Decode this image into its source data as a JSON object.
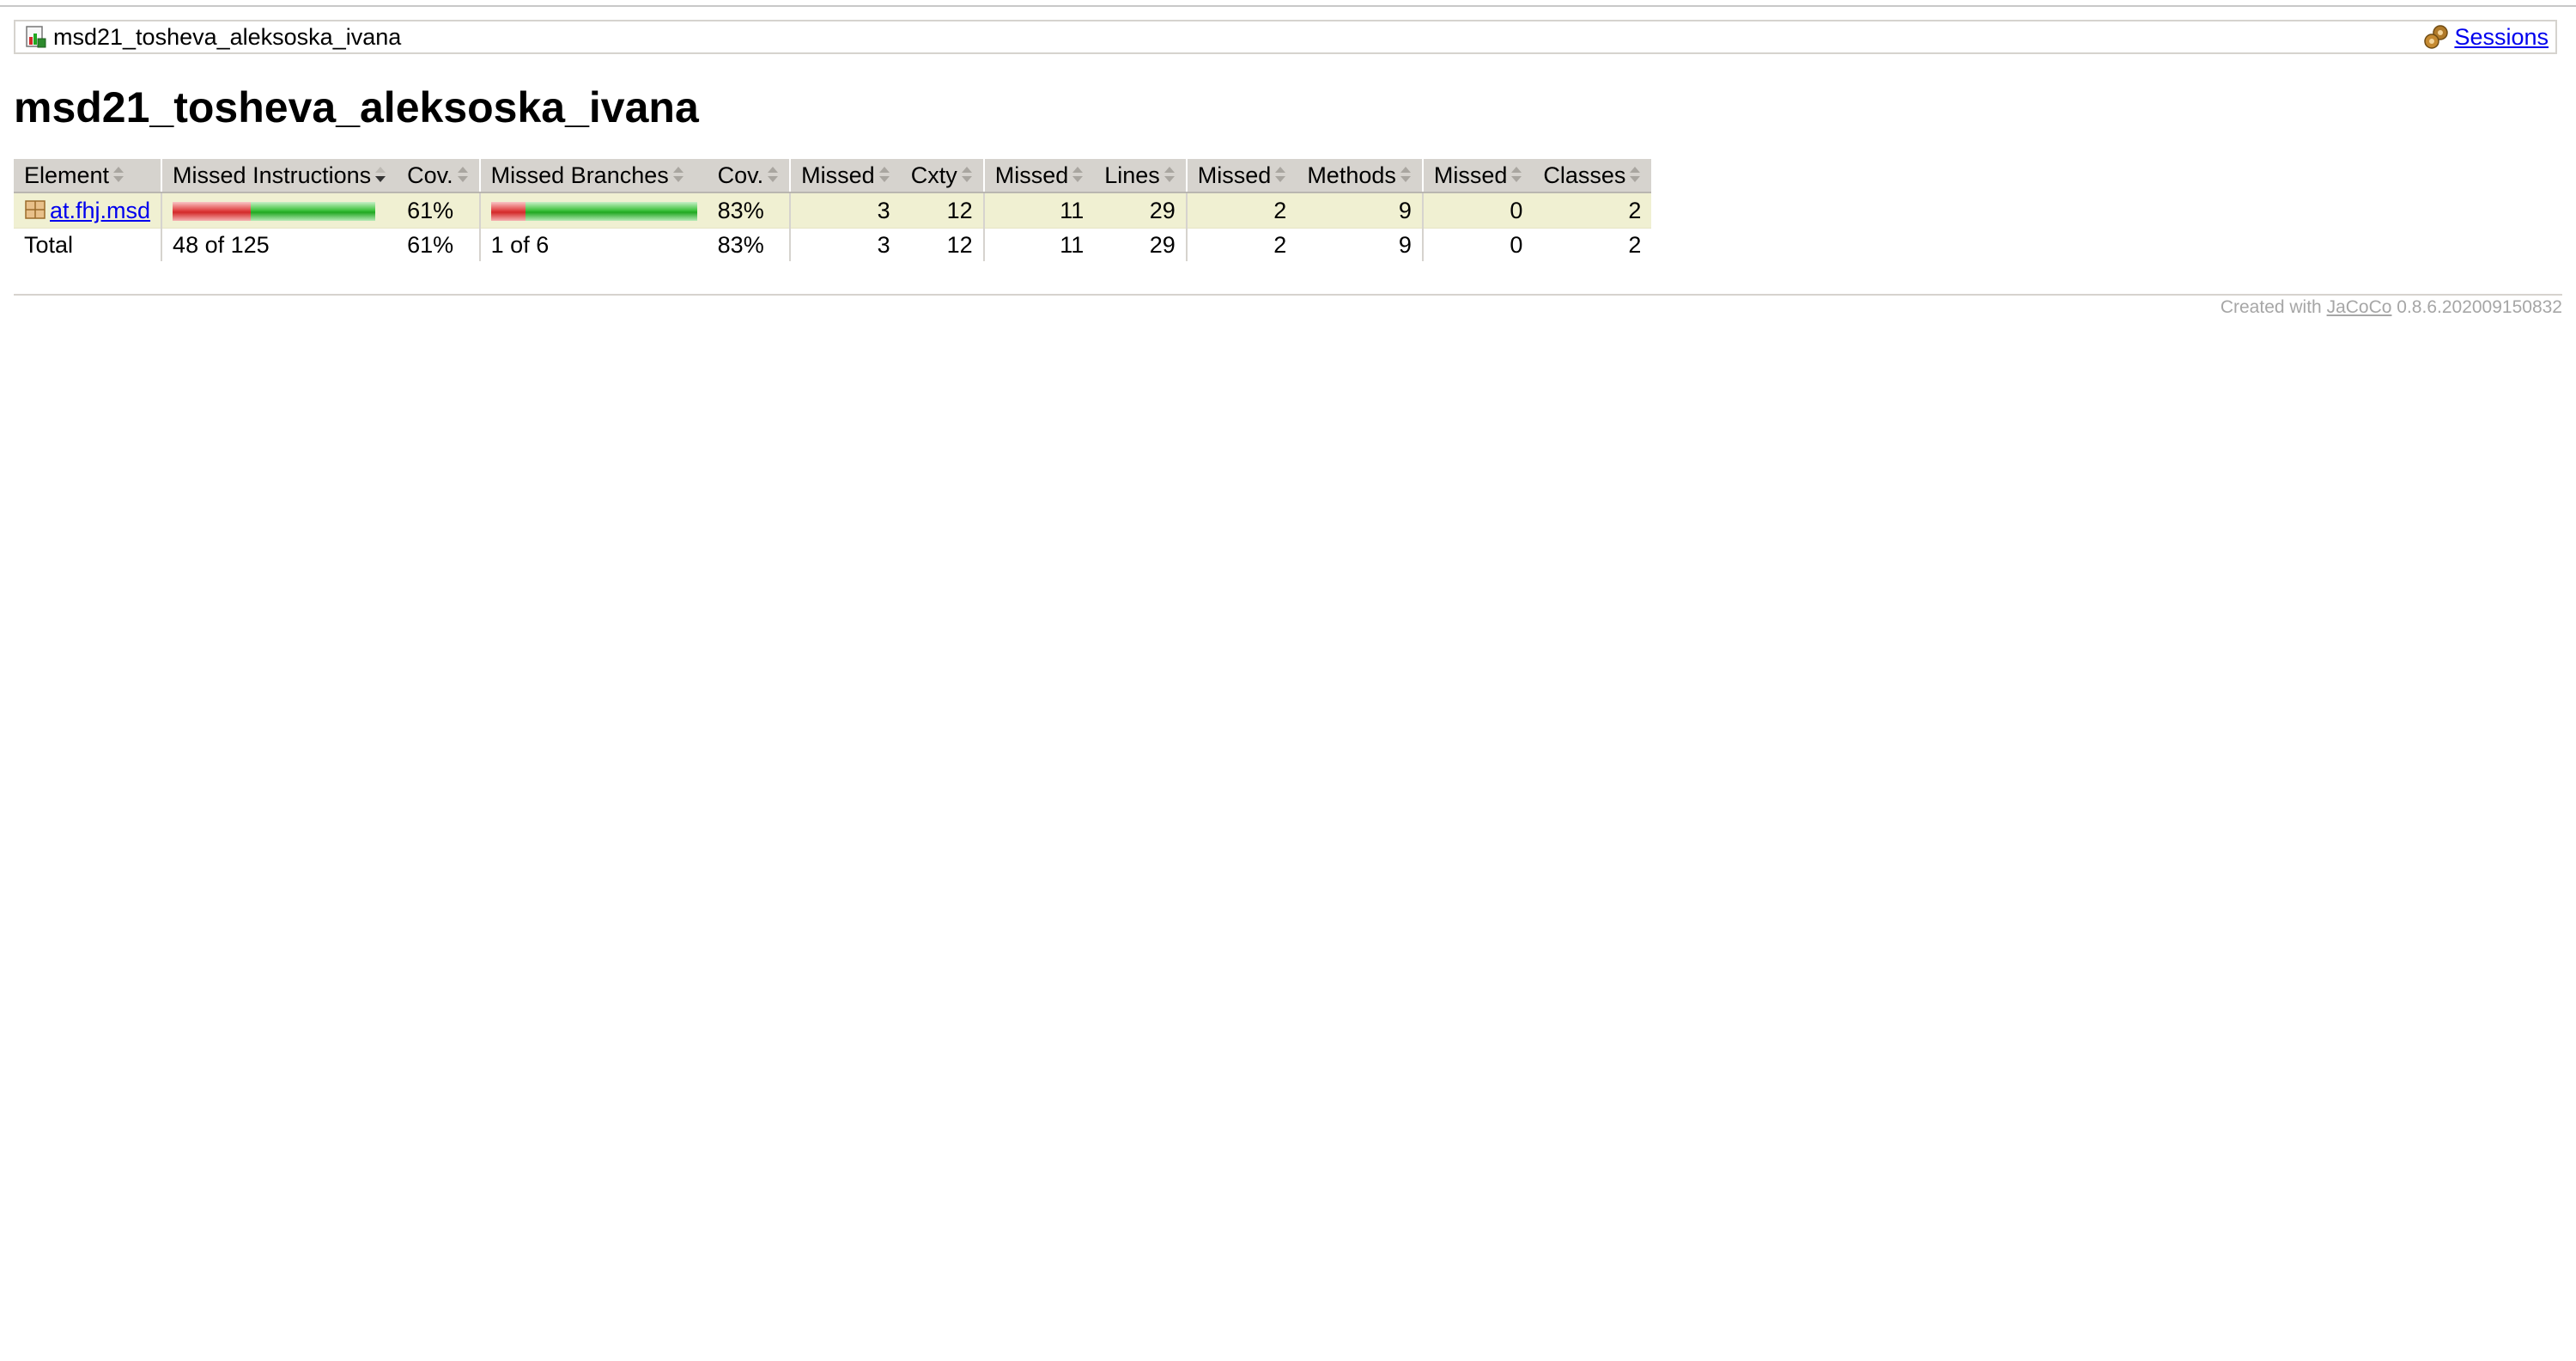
{
  "breadcrumb": {
    "report_name": "msd21_tosheva_aleksoska_ivana",
    "sessions_label": "Sessions"
  },
  "page_title": "msd21_tosheva_aleksoska_ivana",
  "table": {
    "headers": {
      "element": "Element",
      "missed_instructions": "Missed Instructions",
      "cov_instructions": "Cov.",
      "missed_branches": "Missed Branches",
      "cov_branches": "Cov.",
      "missed_cxty": "Missed",
      "cxty": "Cxty",
      "missed_lines": "Missed",
      "lines": "Lines",
      "missed_methods": "Missed",
      "methods": "Methods",
      "missed_classes": "Missed",
      "classes": "Classes"
    },
    "rows": [
      {
        "element": "at.fhj.msd",
        "instructions_missed_fraction": 0.384,
        "instructions_cov": "61%",
        "branches_missed_fraction": 0.167,
        "branches_cov": "83%",
        "missed_cxty": "3",
        "cxty": "12",
        "missed_lines": "11",
        "lines": "29",
        "missed_methods": "2",
        "methods": "9",
        "missed_classes": "0",
        "classes": "2"
      }
    ],
    "total": {
      "label": "Total",
      "instructions": "48 of 125",
      "instructions_cov": "61%",
      "branches": "1 of 6",
      "branches_cov": "83%",
      "missed_cxty": "3",
      "cxty": "12",
      "missed_lines": "11",
      "lines": "29",
      "missed_methods": "2",
      "methods": "9",
      "missed_classes": "0",
      "classes": "2"
    }
  },
  "footer": {
    "created_with": "Created with",
    "tool": "JaCoCo",
    "version": "0.8.6.202009150832"
  },
  "colors": {
    "header_bg": "#d6d3ce",
    "row_highlight": "#f0f0d2",
    "bar_red": "#d32a2a",
    "bar_green": "#22a822",
    "link": "#0000ee"
  },
  "icons": [
    "report-icon",
    "sessions-icon",
    "package-icon",
    "sort-icon",
    "sort-desc-icon"
  ]
}
